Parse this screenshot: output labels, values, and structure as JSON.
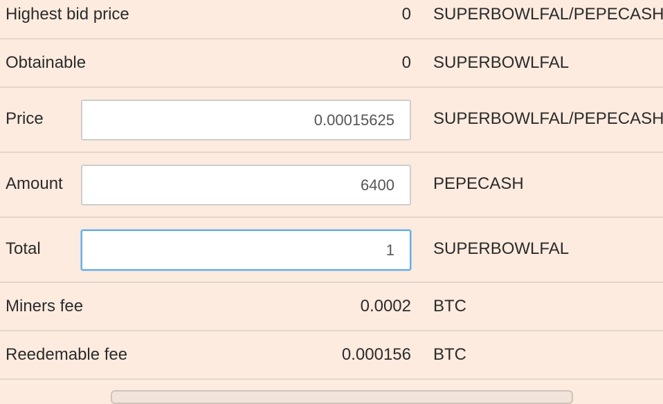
{
  "rows": [
    {
      "label": "Highest bid price",
      "value": "0",
      "unit": "SUPERBOWLFAL/PEPECASH"
    },
    {
      "label": "Obtainable",
      "value": "0",
      "unit": "SUPERBOWLFAL"
    },
    {
      "label": "Price",
      "input_value": "0.00015625",
      "unit": "SUPERBOWLFAL/PEPECASH"
    },
    {
      "label": "Amount",
      "input_value": "6400",
      "unit": "PEPECASH"
    },
    {
      "label": "Total",
      "input_value": "1",
      "unit": "SUPERBOWLFAL"
    },
    {
      "label": "Miners fee",
      "value": "0.0002",
      "unit": "BTC"
    },
    {
      "label": "Reedemable fee",
      "value": "0.000156",
      "unit": "BTC"
    }
  ],
  "colors": {
    "background": "#fdebdf",
    "divider": "#e3d6cd",
    "input_focus": "#66afe9"
  }
}
